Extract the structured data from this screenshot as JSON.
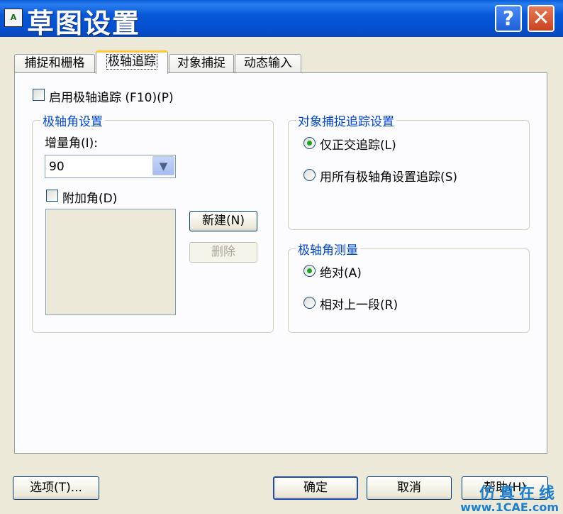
{
  "window": {
    "title": "草图设置",
    "app_icon_text": "A",
    "help_button": "?",
    "close_button": "✕"
  },
  "tabs": [
    {
      "label": "捕捉和栅格",
      "active": false
    },
    {
      "label": "极轴追踪",
      "active": true
    },
    {
      "label": "对象捕捉",
      "active": false
    },
    {
      "label": "动态输入",
      "active": false
    }
  ],
  "polar": {
    "enable_label": "启用极轴追踪 (F10)(P)",
    "enable_checked": false
  },
  "angle_settings": {
    "group_title": "极轴角设置",
    "increment_label": "增量角(I):",
    "increment_value": "90",
    "additional_label": "附加角(D)",
    "additional_checked": false,
    "new_button": "新建(N)",
    "delete_button": "删除"
  },
  "osnap_tracking": {
    "group_title": "对象捕捉追踪设置",
    "options": [
      {
        "label": "仅正交追踪(L)",
        "checked": true
      },
      {
        "label": "用所有极轴角设置追踪(S)",
        "checked": false
      }
    ]
  },
  "measurement": {
    "group_title": "极轴角测量",
    "options": [
      {
        "label": "绝对(A)",
        "checked": true
      },
      {
        "label": "相对上一段(R)",
        "checked": false
      }
    ]
  },
  "footer": {
    "options_button": "选项(T)...",
    "ok_button": "确定",
    "cancel_button": "取消",
    "help_button": "帮助(H)"
  },
  "watermark": {
    "line1": "仿真在线",
    "line2": "www.1CAE.com"
  },
  "colors": {
    "titlebar": "#0758d8",
    "group_title": "#0046d5",
    "active_tab_accent": "#ffc83c",
    "radio_dot": "#21a121"
  }
}
